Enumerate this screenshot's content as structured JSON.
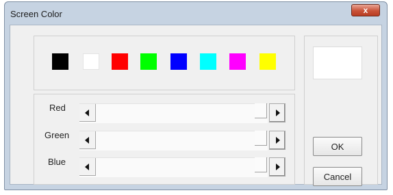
{
  "window": {
    "title": "Screen Color",
    "close_label": "x"
  },
  "palette": {
    "swatches": [
      {
        "name": "black",
        "color": "#000000"
      },
      {
        "name": "white",
        "color": "#ffffff"
      },
      {
        "name": "red",
        "color": "#ff0000"
      },
      {
        "name": "green",
        "color": "#00ff00"
      },
      {
        "name": "blue",
        "color": "#0000ff"
      },
      {
        "name": "cyan",
        "color": "#00ffff"
      },
      {
        "name": "magenta",
        "color": "#ff00ff"
      },
      {
        "name": "yellow",
        "color": "#ffff00"
      }
    ]
  },
  "sliders": [
    {
      "label": "Red",
      "value_fraction": 1.0
    },
    {
      "label": "Green",
      "value_fraction": 1.0
    },
    {
      "label": "Blue",
      "value_fraction": 1.0
    }
  ],
  "preview": {
    "color": "#ffffff"
  },
  "buttons": {
    "ok": "OK",
    "cancel": "Cancel"
  }
}
